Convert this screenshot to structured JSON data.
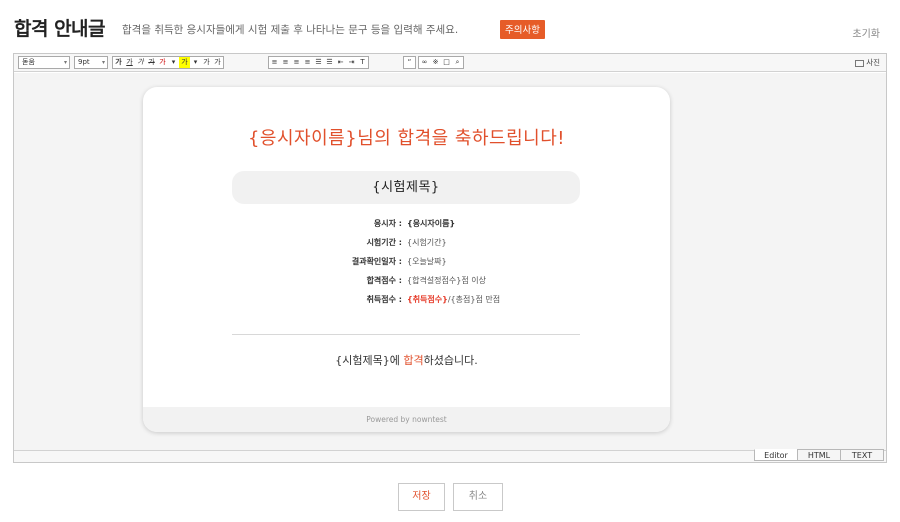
{
  "header": {
    "title": "합격 안내글",
    "description": "합격을 취득한 응시자들에게 시험 제출 후 나타나는 문구 등을 입력해 주세요.",
    "notice_button": "주의사항",
    "reset_label": "초기화"
  },
  "toolbar": {
    "font_select": "돋움",
    "size_select": "9pt",
    "format_icons": [
      "가",
      "가",
      "가",
      "가",
      "가",
      "가",
      "가",
      "가"
    ],
    "photo_label": "사진"
  },
  "card": {
    "title": "{응시자이름}님의 합격을 축하드립니다!",
    "exam_title": "{시험제목}",
    "info": [
      {
        "label": "응시자 :",
        "value": "{응시자이름}"
      },
      {
        "label": "시험기간 :",
        "value": "{시험기간}"
      },
      {
        "label": "결과확인일자 :",
        "value": "{오늘날짜}"
      },
      {
        "label": "합격점수 :",
        "value_prefix": "{합격설정점수}",
        "value_suffix": "점 이상"
      },
      {
        "label": "취득점수 :",
        "value_red": "{취득점수}",
        "value_suffix": "/{총점}점 만점"
      }
    ],
    "result_prefix": "{시험제목}에 ",
    "result_accent": "합격",
    "result_suffix": "하셨습니다.",
    "footer": "Powered by nowntest"
  },
  "mode_tabs": [
    "Editor",
    "HTML",
    "TEXT"
  ],
  "active_mode": "Editor",
  "actions": {
    "save_label": "저장",
    "cancel_label": "취소"
  },
  "colors": {
    "accent": "#e1502c",
    "notice_bg": "#e65c28",
    "red_value": "#e63c2a"
  }
}
